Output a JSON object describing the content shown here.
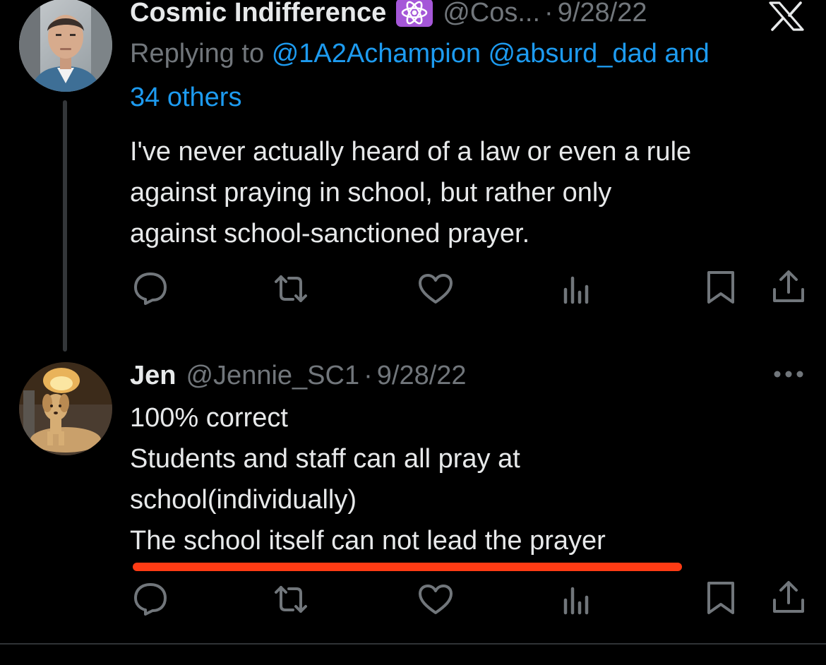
{
  "colors": {
    "background": "#000000",
    "text": "#e7e9ea",
    "muted": "#71767b",
    "link": "#1d9bf0",
    "badge": "#a557d8",
    "highlight_underline": "#ff3b14"
  },
  "tweets": [
    {
      "display_name": "Cosmic Indifference",
      "badge_icon": "atom-icon",
      "handle": "@Cos...",
      "separator": "·",
      "date": "9/28/22",
      "close_icon": "x-icon",
      "reply_prefix": "Replying to",
      "reply_mentions_1": "@1A2Achampion @absurd_dad and",
      "reply_mentions_2": "34 others",
      "text_lines": [
        "I've never actually heard of a law or even a rule",
        "against praying in school, but rather only",
        "against school-sanctioned prayer."
      ]
    },
    {
      "display_name": "Jen",
      "handle": "@Jennie_SC1",
      "separator": "·",
      "date": "9/28/22",
      "more_icon": "more-icon",
      "text_lines": [
        "100% correct",
        "Students and staff can all pray at",
        "school(individually)",
        "The school itself can not lead the prayer"
      ]
    }
  ],
  "actions": [
    "reply-icon",
    "retweet-icon",
    "like-icon",
    "views-icon",
    "bookmark-icon",
    "share-icon"
  ]
}
